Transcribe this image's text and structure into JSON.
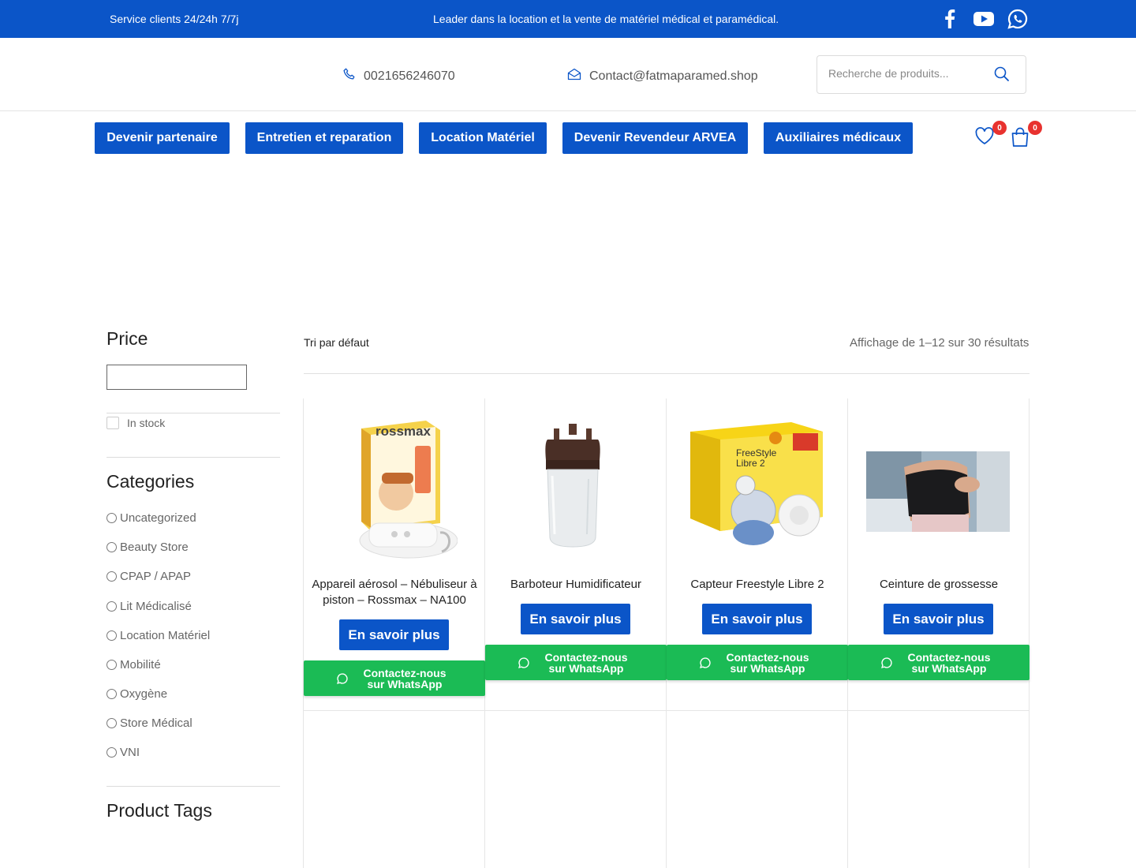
{
  "topbar": {
    "service": "Service clients 24/24h 7/7j",
    "tagline": "Leader dans la location et la vente de matériel médical et paramédical.",
    "icons": [
      "facebook-icon",
      "youtube-icon",
      "whatsapp-icon"
    ]
  },
  "header": {
    "phone": "0021656246070",
    "email": "Contact@fatmaparamed.shop",
    "search_placeholder": "Recherche de produits..."
  },
  "nav": {
    "items": [
      "Devenir partenaire",
      "Entretien et reparation",
      "Location Matériel",
      "Devenir Revendeur ARVEA",
      "Auxiliaires médicaux"
    ],
    "wishlist_count": "0",
    "cart_count": "0"
  },
  "sidebar": {
    "price_title": "Price",
    "in_stock": "In stock",
    "categories_title": "Categories",
    "categories": [
      "Uncategorized",
      "Beauty Store",
      "CPAP / APAP",
      "Lit Médicalisé",
      "Location Matériel",
      "Mobilité",
      "Oxygène",
      "Store Médical",
      "VNI"
    ],
    "tags_title": "Product Tags"
  },
  "main": {
    "sort_label": "Tri par défaut",
    "result_count": "Affichage de 1–12 sur 30 résultats",
    "products": [
      {
        "title": "Appareil aérosol – Nébuliseur à piston – Rossmax – NA100",
        "more": "En savoir plus",
        "whatsapp": "Contactez-nous sur WhatsApp",
        "brand_text": "rossmax"
      },
      {
        "title": "Barboteur Humidificateur",
        "more": "En savoir plus",
        "whatsapp": "Contactez-nous sur WhatsApp"
      },
      {
        "title": "Capteur Freestyle Libre 2",
        "more": "En savoir plus",
        "whatsapp": "Contactez-nous sur WhatsApp",
        "brand_text": "FreeStyle Libre 2"
      },
      {
        "title": "Ceinture de grossesse",
        "more": "En savoir plus",
        "whatsapp": "Contactez-nous sur WhatsApp"
      }
    ]
  },
  "colors": {
    "primary": "#0b55c8",
    "whatsapp_green": "#1bbb55",
    "badge_red": "#e8322f"
  }
}
